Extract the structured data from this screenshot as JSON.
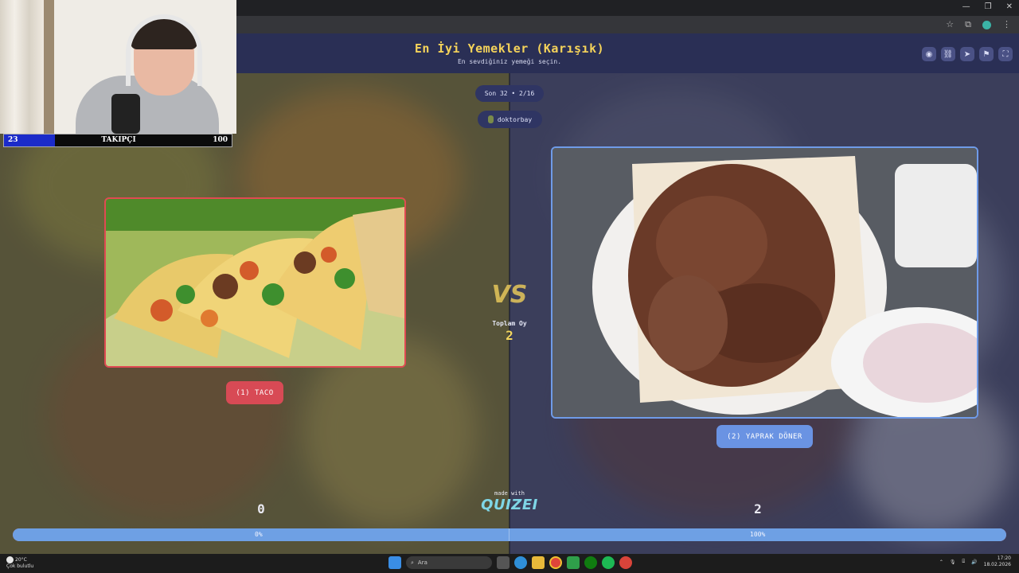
{
  "app": {
    "title": "En İyi Yemekler (Karışık)",
    "subtitle": "En sevdiğiniz yemeği seçin.",
    "header_icons": [
      "eye-icon",
      "link-icon",
      "send-icon",
      "flag-icon",
      "fullscreen-icon"
    ]
  },
  "round": {
    "label": "Son 32 • 2/16",
    "user": "doktorbay"
  },
  "webcam_overlay": {
    "follow_start": "23",
    "follow_label": "TAKIPÇI",
    "follow_end": "100"
  },
  "options": {
    "left": {
      "label": "(1) TACO",
      "score": "0",
      "percent": "0%",
      "accent": "#d84a55"
    },
    "right": {
      "label": "(2) YAPRAK DÖNER",
      "score": "2",
      "percent": "100%",
      "accent": "#6a93e3"
    }
  },
  "versus": {
    "vs_text": "VS",
    "total_label": "Toplam Oy",
    "total_value": "2"
  },
  "branding": {
    "made_with": "made with",
    "brand": "QUIZEI"
  },
  "progress": {
    "right_fraction": 1.0
  },
  "taskbar": {
    "weather_temp": "20°C",
    "weather_desc": "Çok bulutlu",
    "search_placeholder": "Ara",
    "time": "17:20",
    "date": "18.02.2026"
  },
  "colors": {
    "header_bg": "#2a2f55",
    "title": "#f5d35a",
    "left_accent": "#d84a55",
    "right_accent": "#6a93e3"
  }
}
